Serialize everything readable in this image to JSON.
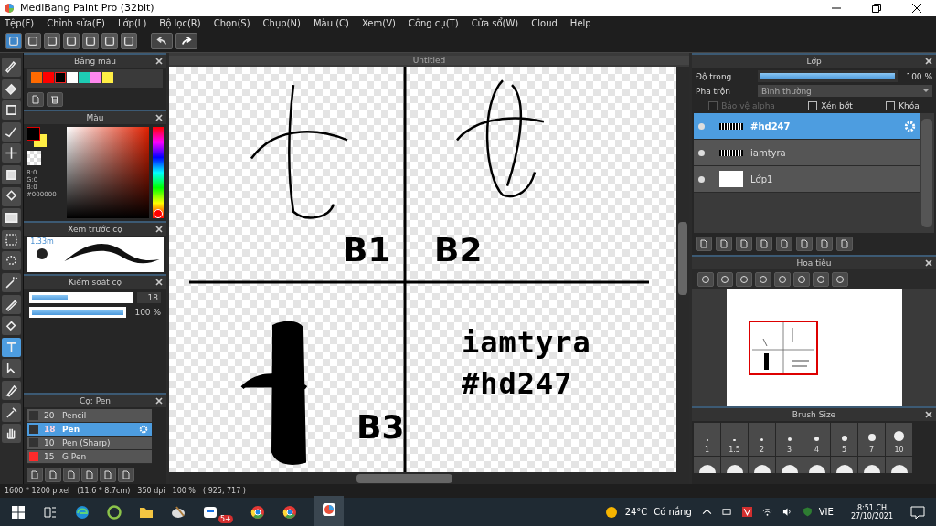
{
  "window": {
    "title": "MediBang Paint Pro (32bit)"
  },
  "menu": [
    "Tệp(F)",
    "Chỉnh sửa(E)",
    "Lớp(L)",
    "Bộ lọc(R)",
    "Chọn(S)",
    "Chụp(N)",
    "Màu (C)",
    "Xem(V)",
    "Công cụ(T)",
    "Cửa sổ(W)",
    "Cloud",
    "Help"
  ],
  "tools": [
    {
      "selected": false
    },
    {
      "selected": false
    },
    {
      "selected": false
    },
    {
      "selected": false
    },
    {
      "selected": false
    },
    {
      "selected": false
    },
    {
      "selected": false
    },
    {
      "selected": false
    },
    {
      "selected": false
    },
    {
      "selected": false
    },
    {
      "selected": false
    },
    {
      "selected": false
    },
    {
      "selected": false
    },
    {
      "selected": true
    },
    {
      "selected": false
    },
    {
      "selected": false
    },
    {
      "selected": false
    },
    {
      "selected": false
    }
  ],
  "palette": {
    "title": "Bảng màu",
    "swatches": [
      {
        "color": "#ff6a00",
        "selected": false
      },
      {
        "color": "#ff0000",
        "selected": false
      },
      {
        "color": "#000000",
        "selected": true
      },
      {
        "color": "#ffffff",
        "selected": false
      },
      {
        "color": "#1ecbb4",
        "selected": false
      },
      {
        "color": "#ff88ee",
        "selected": false
      },
      {
        "color": "#ffee44",
        "selected": false
      }
    ],
    "name": "---"
  },
  "color": {
    "title": "Màu",
    "hue": {
      "level": 0.0
    },
    "r": "R:0",
    "g": "G:0",
    "b": "B:0",
    "hex": "#000000"
  },
  "brush_preview": {
    "title": "Xem trước cọ",
    "size": "1.33m"
  },
  "brush_control": {
    "title": "Kiểm soát cọ",
    "sliders": [
      {
        "level": 0.36,
        "reading": "18"
      },
      {
        "level": 1.0,
        "reading": "100 %"
      }
    ]
  },
  "brushes": {
    "title": "Cọ: Pen",
    "items": [
      {
        "size": "20",
        "name": "Pencil",
        "color": "#333333",
        "selected": false
      },
      {
        "size": "18",
        "name": "Pen",
        "color": "#333333",
        "selected": true
      },
      {
        "size": "10",
        "name": "Pen (Sharp)",
        "color": "#333333",
        "selected": false
      },
      {
        "size": "15",
        "name": "G Pen",
        "color": "#ff2a2a",
        "selected": false
      }
    ]
  },
  "canvas": {
    "tab": "Untitled",
    "labels": [
      "B1",
      "B2",
      "B3"
    ],
    "text_lines": [
      "iamtyra",
      "#hd247"
    ]
  },
  "layers": {
    "title": "Lớp",
    "opacity_label": "Độ trong",
    "opacity": {
      "level": 1.0,
      "reading": "100 %"
    },
    "blend_label": "Pha trộn",
    "blend": "Bình thường",
    "options": [
      {
        "label": "Bảo vệ alpha",
        "checked": false,
        "disabled": true
      },
      {
        "label": "Xén bớt",
        "checked": false,
        "disabled": false
      },
      {
        "label": "Khóa",
        "checked": false,
        "disabled": false
      }
    ],
    "items": [
      {
        "name": "#hd247",
        "selected": true
      },
      {
        "name": "iamtyra",
        "selected": false
      },
      {
        "name": "Lớp1",
        "selected": false
      }
    ]
  },
  "navigator": {
    "title": "Hoa tiêu"
  },
  "brush_size": {
    "title": "Brush Size",
    "sizes": [
      "1",
      "1.5",
      "2",
      "3",
      "4",
      "5",
      "7",
      "10"
    ]
  },
  "status_bar": {
    "size": "1600 * 1200 pixel",
    "cm": "(11.6 * 8.7cm)",
    "dpi": "350 dpi",
    "zoom": "100 %",
    "pos": "( 925, 717 )"
  },
  "taskbar": {
    "badge": "5+",
    "temp": "24°C",
    "weather": "Có nắng",
    "lang": "VIE",
    "time": "8:51 CH",
    "date": "27/10/2021"
  }
}
